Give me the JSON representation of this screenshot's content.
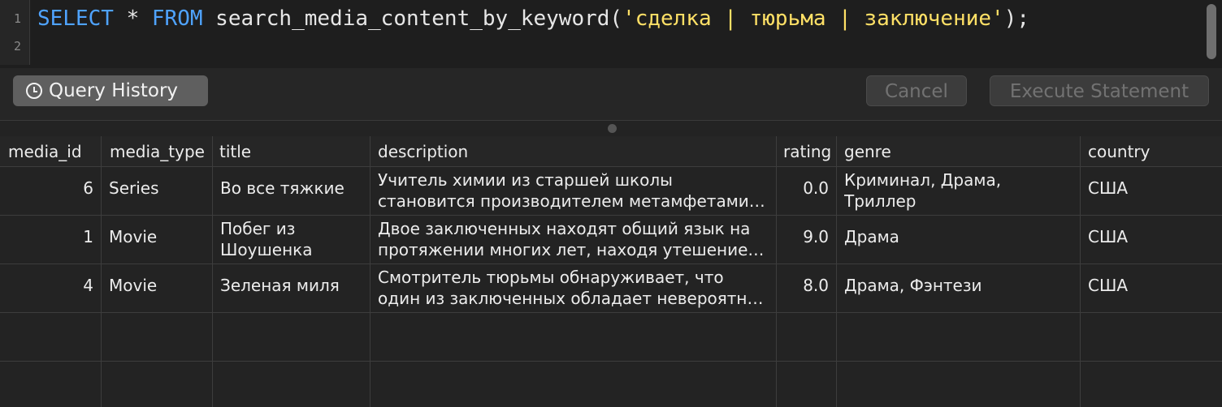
{
  "editor": {
    "line_numbers": [
      "1",
      "2"
    ],
    "query": {
      "kw_select": "SELECT",
      "star": " * ",
      "kw_from": "FROM",
      "fn": " search_media_content_by_keyword(",
      "arg": "'сделка | тюрьма | заключение'",
      "tail": ");"
    }
  },
  "toolbar": {
    "history_label": "Query History",
    "cancel_label": "Cancel",
    "execute_label": "Execute Statement"
  },
  "table": {
    "columns": [
      "media_id",
      "media_type",
      "title",
      "description",
      "rating",
      "genre",
      "country"
    ],
    "rows": [
      {
        "media_id": "6",
        "media_type": "Series",
        "title": "Во все тяжкие",
        "description_1": "Учитель химии из старшей школы",
        "description_2": "становится производителем метамфетами…",
        "rating": "0.0",
        "genre_1": "Криминал, Драма,",
        "genre_2": "Триллер",
        "country": "США"
      },
      {
        "media_id": "1",
        "media_type": "Movie",
        "title_1": "Побег из",
        "title_2": "Шоушенка",
        "description_1": "Двое заключенных находят общий язык на",
        "description_2": "протяжении многих лет, находя утешение…",
        "rating": "9.0",
        "genre": "Драма",
        "country": "США"
      },
      {
        "media_id": "4",
        "media_type": "Movie",
        "title": "Зеленая миля",
        "description_1": "Смотритель тюрьмы обнаруживает, что",
        "description_2": "один из заключенных обладает невероятн…",
        "rating": "8.0",
        "genre": "Драма, Фэнтези",
        "country": "США"
      }
    ]
  }
}
